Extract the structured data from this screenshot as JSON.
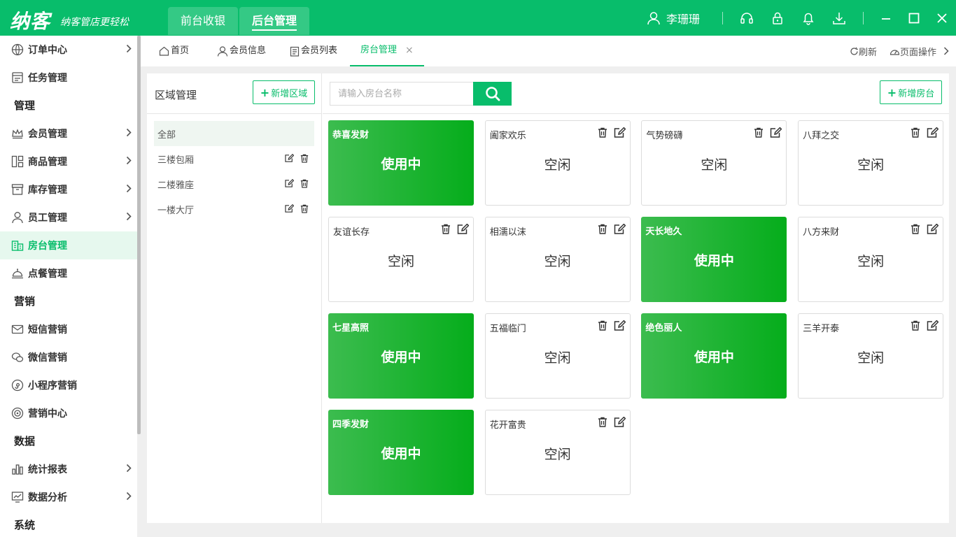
{
  "brand": {
    "logo": "纳客",
    "slogan": "纳客管店更轻松"
  },
  "top_nav": [
    "前台收银",
    "后台管理"
  ],
  "user": {
    "name": "李珊珊"
  },
  "sidebar": {
    "items": [
      {
        "label": "订单中心",
        "icon": "globe-icon",
        "arrow": true
      },
      {
        "label": "任务管理",
        "icon": "task-icon",
        "arrow": false
      },
      {
        "section": "管理"
      },
      {
        "label": "会员管理",
        "icon": "crown-icon",
        "arrow": true
      },
      {
        "label": "商品管理",
        "icon": "product-icon",
        "arrow": true
      },
      {
        "label": "库存管理",
        "icon": "inventory-icon",
        "arrow": true
      },
      {
        "label": "员工管理",
        "icon": "staff-icon",
        "arrow": true
      },
      {
        "label": "房台管理",
        "icon": "room-icon",
        "arrow": false,
        "active": true
      },
      {
        "label": "点餐管理",
        "icon": "bell-dish-icon",
        "arrow": false
      },
      {
        "section": "营销"
      },
      {
        "label": "短信营销",
        "icon": "mail-icon",
        "arrow": false
      },
      {
        "label": "微信营销",
        "icon": "wechat-icon",
        "arrow": false
      },
      {
        "label": "小程序营销",
        "icon": "miniapp-icon",
        "arrow": false
      },
      {
        "label": "营销中心",
        "icon": "target-icon",
        "arrow": false
      },
      {
        "section": "数据"
      },
      {
        "label": "统计报表",
        "icon": "bar-chart-icon",
        "arrow": true
      },
      {
        "label": "数据分析",
        "icon": "trend-icon",
        "arrow": true
      },
      {
        "section": "系统"
      }
    ]
  },
  "tabs": [
    {
      "label": "首页",
      "icon": "home-icon"
    },
    {
      "label": "会员信息",
      "icon": "person-icon"
    },
    {
      "label": "会员列表",
      "icon": "list-icon"
    },
    {
      "label": "房台管理",
      "active": true,
      "close": "×"
    }
  ],
  "tab_actions": {
    "refresh": "刷新",
    "page_ops": "页面操作"
  },
  "area": {
    "title": "区域管理",
    "add_label": "新增区域",
    "items": [
      {
        "label": "全部",
        "selected": true
      },
      {
        "label": "三楼包厢"
      },
      {
        "label": "二楼雅座"
      },
      {
        "label": "一楼大厅"
      }
    ]
  },
  "rooms": {
    "search_placeholder": "请输入房台名称",
    "add_label": "新增房台",
    "cards": [
      {
        "name": "恭喜发财",
        "status": "使用中",
        "busy": true
      },
      {
        "name": "阖家欢乐",
        "status": "空闲",
        "busy": false
      },
      {
        "name": "气势磅礴",
        "status": "空闲",
        "busy": false
      },
      {
        "name": "八拜之交",
        "status": "空闲",
        "busy": false
      },
      {
        "name": "友谊长存",
        "status": "空闲",
        "busy": false
      },
      {
        "name": "相濡以沫",
        "status": "空闲",
        "busy": false
      },
      {
        "name": "天长地久",
        "status": "使用中",
        "busy": true
      },
      {
        "name": "八方来财",
        "status": "空闲",
        "busy": false
      },
      {
        "name": "七星高照",
        "status": "使用中",
        "busy": true
      },
      {
        "name": "五福临门",
        "status": "空闲",
        "busy": false
      },
      {
        "name": "绝色丽人",
        "status": "使用中",
        "busy": true
      },
      {
        "name": "三羊开泰",
        "status": "空闲",
        "busy": false
      },
      {
        "name": "四季发财",
        "status": "使用中",
        "busy": true
      },
      {
        "name": "花开富贵",
        "status": "空闲",
        "busy": false
      }
    ]
  },
  "colors": {
    "brand": "#08bd6b",
    "busy": "#05ad1b"
  }
}
